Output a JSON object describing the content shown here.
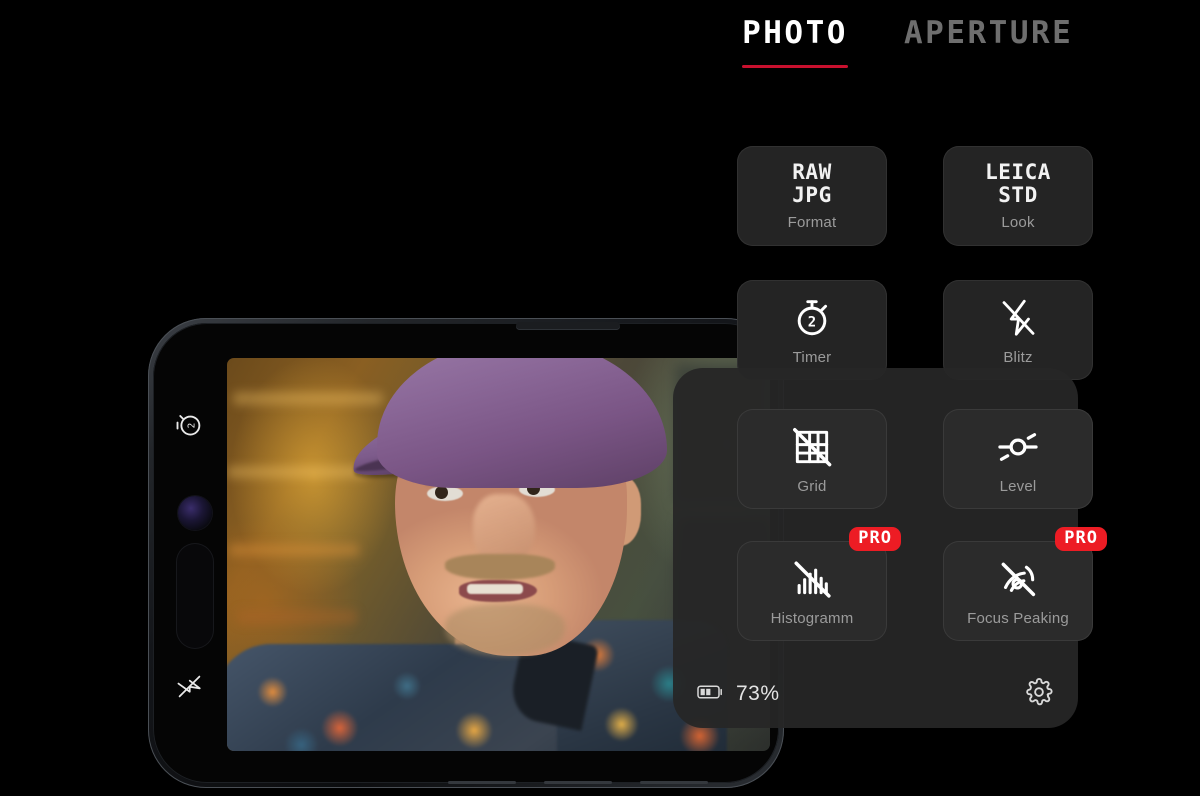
{
  "tabs": [
    {
      "label": "PHOTO",
      "active": true,
      "name": "tab-photo"
    },
    {
      "label": "APERTURE",
      "active": false,
      "name": "tab-aperture"
    }
  ],
  "quick_tiles": [
    {
      "value_line1": "RAW",
      "value_line2": "JPG",
      "caption": "Format",
      "icon": "raw-jpg-text"
    },
    {
      "value_line1": "LEICA",
      "value_line2": "STD",
      "caption": "Look",
      "icon": "leica-std-text"
    },
    {
      "caption": "Timer",
      "icon": "stopwatch-icon",
      "badge_value": "2"
    },
    {
      "caption": "Blitz",
      "icon": "flash-off-icon"
    }
  ],
  "panel": {
    "tiles": [
      {
        "caption": "Grid",
        "icon": "grid-off-icon",
        "pro": false
      },
      {
        "caption": "Level",
        "icon": "level-icon",
        "pro": false
      },
      {
        "caption": "Histogramm",
        "icon": "histogram-off-icon",
        "pro": true,
        "pro_label": "PRO"
      },
      {
        "caption": "Focus Peaking",
        "icon": "focus-peaking-off-icon",
        "pro": true,
        "pro_label": "PRO"
      }
    ],
    "footer": {
      "battery_icon": "battery-icon",
      "battery_percent": "73%",
      "settings_icon": "gear-icon"
    }
  },
  "phone": {
    "bezel_icons": [
      {
        "icon": "stopwatch-icon",
        "badge_value": "2"
      },
      {
        "icon": "flash-off-icon"
      }
    ],
    "viewfinder": {
      "subject": "man-with-purple-cap-and-patterned-shirt"
    }
  },
  "colors": {
    "background": "#000000",
    "accent_red": "#c8102e",
    "pro_badge_red": "#ed1c24",
    "tile_bg": "#242424",
    "panel_bg": "#262626",
    "text_primary": "#ffffff",
    "text_secondary": "#9b9b9b",
    "tab_inactive": "#6e6e6e"
  }
}
